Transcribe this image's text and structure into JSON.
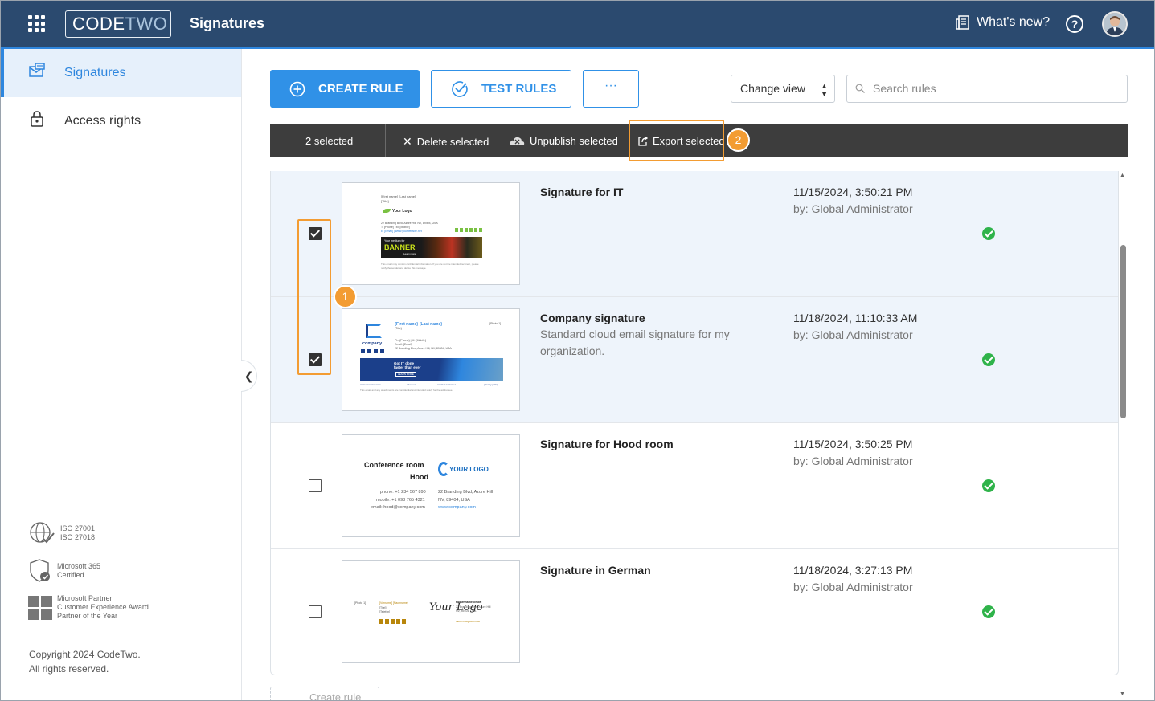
{
  "app": {
    "brand_code": "CODE",
    "brand_two": "TWO",
    "title": "Signatures",
    "whats_new": "What's new?",
    "help": "?"
  },
  "sidebar": {
    "items": [
      {
        "label": "Signatures",
        "icon": "signatures-icon",
        "active": true
      },
      {
        "label": "Access rights",
        "icon": "lock-icon",
        "active": false
      }
    ],
    "certs": [
      {
        "lines": [
          "ISO 27001",
          "ISO 27018"
        ],
        "icon": "globe-check-icon"
      },
      {
        "lines": [
          "Microsoft 365",
          "Certified"
        ],
        "icon": "shield-check-icon"
      },
      {
        "lines": [
          "Microsoft Partner",
          "Customer Experience Award",
          "Partner of the Year"
        ],
        "icon": "microsoft-logo-icon"
      }
    ],
    "copyright_line1": "Copyright 2024 CodeTwo.",
    "copyright_line2": "All rights reserved."
  },
  "toolbar": {
    "create_rule": "CREATE RULE",
    "test_rules": "TEST RULES",
    "more": "···",
    "change_view": "Change view",
    "search_placeholder": "Search rules"
  },
  "actionbar": {
    "selected": "2 selected",
    "delete": "Delete selected",
    "unpublish": "Unpublish selected",
    "export": "Export selected"
  },
  "callouts": {
    "one": "1",
    "two": "2"
  },
  "rules": [
    {
      "name": "Signature for IT",
      "description": "",
      "date": "11/15/2024, 3:50:21 PM",
      "by": "by: Global Administrator",
      "checked": true,
      "status": "published"
    },
    {
      "name": "Company signature",
      "description": "Standard cloud email signature for my organization.",
      "date": "11/18/2024, 11:10:33 AM",
      "by": "by: Global Administrator",
      "checked": true,
      "status": "published"
    },
    {
      "name": "Signature for Hood room",
      "description": "",
      "date": "11/15/2024, 3:50:25 PM",
      "by": "by: Global Administrator",
      "checked": false,
      "status": "published"
    },
    {
      "name": "Signature in German",
      "description": "",
      "date": "11/18/2024, 3:27:13 PM",
      "by": "by: Global Administrator",
      "checked": false,
      "status": "published"
    }
  ],
  "thumbs": {
    "it": {
      "name": "[First name] [Last name]",
      "title": "[Title]",
      "logo": "Your Logo",
      "addr": "22 Branding Blvd, Azure Hill, NV, 89404, USA",
      "phone": "T: [Phone] | M: [Mobile]",
      "web": "E: [Email] | www.yourwebsite.net",
      "banner_top": "Your medium for",
      "banner_big": "BANNER",
      "banner_sub": "Learn more",
      "disclaimer": "This email may contain confidential information. If you are not the intended recipient, please notify the sender and delete this message."
    },
    "company": {
      "name": "{First name} {Last name}",
      "title": "{Title}",
      "photo": "{Photo 1}",
      "brand": "company",
      "phone": "Ph: {Phone} | M: {Mobile}",
      "email": "Email: {Email}",
      "addr": "22 Branding Blvd, Azure Hill, NV, 89404, USA",
      "banner_top": "Got IT done",
      "banner_mid": "faster than ever",
      "banner_btn": "LEARN MORE",
      "links": [
        "www.company.com",
        "about us",
        "contact customer",
        "privacy policy"
      ],
      "disclaimer": "This email and any attachments are confidential and intended solely for the addressee."
    },
    "hood": {
      "line1": "Conference room",
      "line2": "Hood",
      "logo": "YOUR LOGO",
      "phone": "phone: +1 234 567 890",
      "mobile": "mobile: +1 098 765 4321",
      "email": "email: hood@company.com",
      "addr1": "22 Branding Blvd, Azure Hill",
      "addr2": "NV, 89404, USA",
      "web": "www.company.com"
    },
    "german": {
      "photo": "[Photo 1]",
      "name": "[Vorname] [Nachname]",
      "title": "[Titel]",
      "phone": "[Telefon]",
      "logo": "Your Logo",
      "company": "Firmenname GmbH",
      "addr1": "22 Branding Blvd, Azure Hill",
      "addr2": "NV, 89404, USA",
      "web": "www.company.com"
    }
  },
  "ghost": {
    "label": "Create rule"
  },
  "colors": {
    "topbar": "#2b4a6f",
    "accent": "#3091e7",
    "highlight": "#f39c32",
    "status_ok": "#2fb34a",
    "actionbar": "#3d3d3d"
  }
}
